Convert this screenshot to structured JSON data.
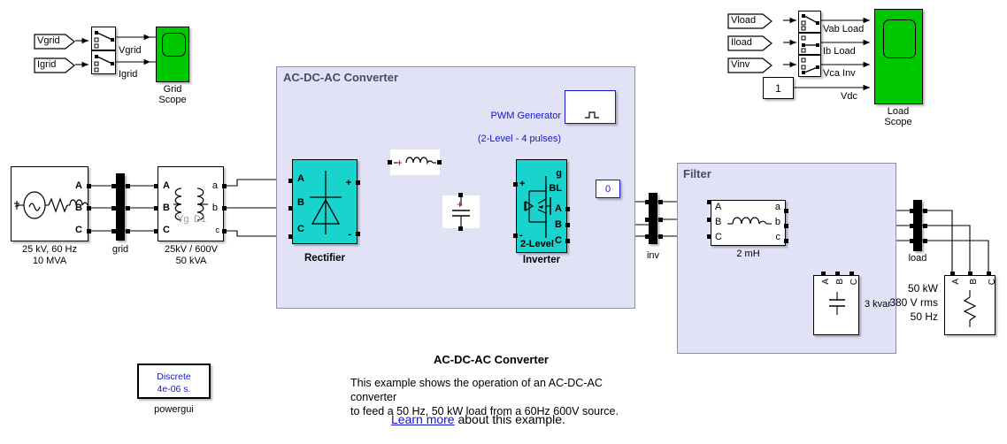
{
  "diagram": {
    "title": "AC-DC-AC Converter",
    "description_line1": "This example shows the operation of an AC-DC-AC converter",
    "description_line2": "to feed a 50 Hz, 50 kW load from a 60Hz 600V source.",
    "learn_link": "Learn more",
    "learn_rest": " about this example."
  },
  "grid_scope_group": {
    "inputs": [
      {
        "label": "Vgrid"
      },
      {
        "label": "Igrid"
      }
    ],
    "signal_labels": [
      "Vgrid",
      "Igrid"
    ],
    "scope_name_line1": "Grid",
    "scope_name_line2": "Scope"
  },
  "load_scope_group": {
    "inputs": [
      {
        "label": "Vload"
      },
      {
        "label": "Iload"
      },
      {
        "label": "Vinv"
      }
    ],
    "constant_value": "1",
    "signal_labels": [
      "Vab Load",
      "Ib Load",
      "Vca Inv",
      "Vdc"
    ],
    "scope_name_line1": "Load",
    "scope_name_line2": "Scope"
  },
  "source": {
    "caption_line1": "25 kV, 60 Hz",
    "caption_line2": "10 MVA",
    "ports": [
      "A",
      "B",
      "C"
    ]
  },
  "grid_bus": {
    "label": "grid"
  },
  "transformer": {
    "caption_line1": "25kV / 600V",
    "caption_line2": "50 kVA",
    "left_ports": [
      "A",
      "B",
      "C"
    ],
    "right_ports": [
      "a",
      "b",
      "c"
    ],
    "winding_left": "Yg",
    "winding_right": "D1"
  },
  "converter": {
    "title": "AC-DC-AC Converter",
    "rectifier": {
      "name": "Rectifier",
      "left_ports": [
        "A",
        "B",
        "C"
      ],
      "right_ports": [
        "+",
        "-"
      ]
    },
    "inverter": {
      "name": "Inverter",
      "inner_label": "2-Level",
      "left_ports": [
        "+",
        "-"
      ],
      "right_ports": [
        "g",
        "BL",
        "A",
        "B",
        "C"
      ]
    },
    "pwm": {
      "label_line1": "PWM Generator",
      "label_line2": "(2-Level - 4 pulses)"
    },
    "blocking_constant": "0"
  },
  "inv_bus": {
    "label": "inv"
  },
  "filter": {
    "title": "Filter",
    "inductor": {
      "caption": "2 mH",
      "left_ports": [
        "A",
        "B",
        "C"
      ],
      "right_ports": [
        "a",
        "b",
        "c"
      ]
    },
    "capacitor_bank": {
      "caption": "3 kvar",
      "ports": [
        "A",
        "B",
        "C"
      ]
    }
  },
  "load_bus": {
    "label": "load"
  },
  "load": {
    "caption_line1": "50 kW",
    "caption_line2": "380 V rms",
    "caption_line3": "50 Hz",
    "ports": [
      "A",
      "B",
      "C"
    ]
  },
  "powergui": {
    "line1": "Discrete",
    "line2": "4e-06 s.",
    "caption": "powergui"
  },
  "colors": {
    "teal_block": "#19d3cd",
    "scope_green": "#00c800",
    "subsystem_fill": "#e2e2f7",
    "subsystem_border": "#8d8db5",
    "blue_signal": "#1515cd",
    "wire": "#000000"
  }
}
